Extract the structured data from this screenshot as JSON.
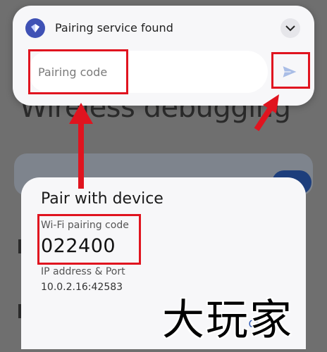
{
  "background": {
    "title": "Wireless debugging"
  },
  "notification": {
    "title": "Pairing service found",
    "input_placeholder": "Pairing code",
    "icons": {
      "app": "android-app-icon",
      "expand": "chevron-down-icon",
      "send": "send-icon"
    }
  },
  "dialog": {
    "title": "Pair with device",
    "code_label": "Wi-Fi pairing code",
    "code": "022400",
    "ip_label": "IP address & Port",
    "ip": "10.0.2.16:42583",
    "cancel": "Cancel"
  },
  "watermark": {
    "text": "大玩家"
  },
  "colors": {
    "annotation": "#e0141f",
    "accent": "#3f51b5",
    "link": "#2756b5"
  }
}
